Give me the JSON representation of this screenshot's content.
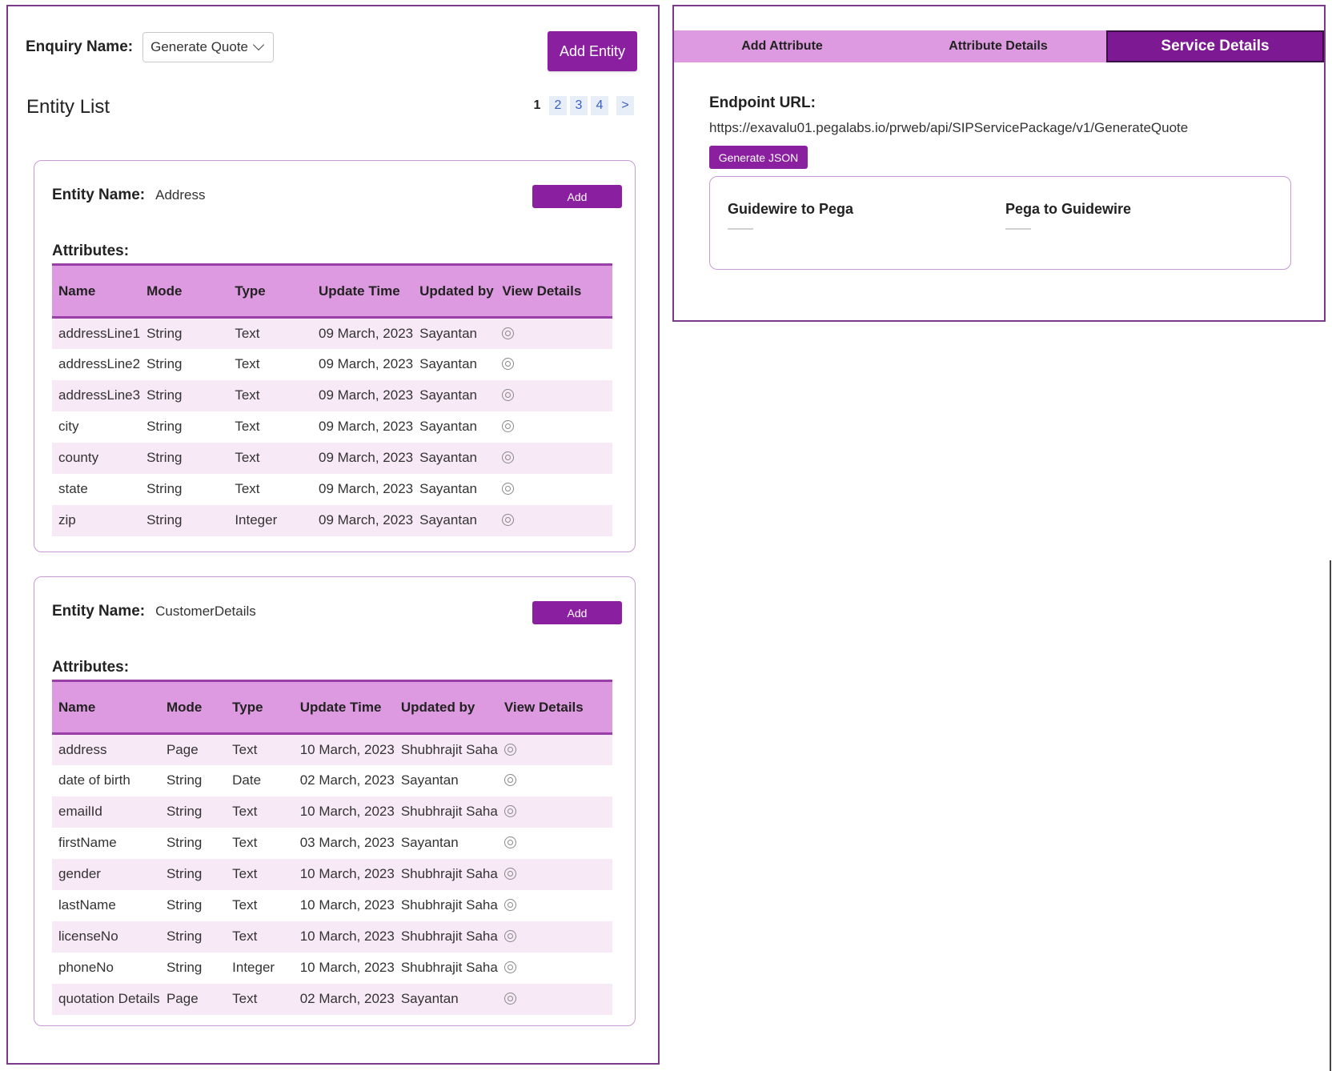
{
  "enquiry": {
    "label": "Enquiry Name:",
    "selected": "Generate Quote"
  },
  "add_entity_label": "Add Entity",
  "entity_list_title": "Entity List",
  "pagination": {
    "current": "1",
    "pages": [
      "2",
      "3",
      "4"
    ],
    "next": ">"
  },
  "entities": [
    {
      "name_label": "Entity Name:",
      "name": "Address",
      "add_label": "Add",
      "attributes_label": "Attributes:",
      "columns": [
        "Name",
        "Mode",
        "Type",
        "Update Time",
        "Updated by",
        "View Details"
      ],
      "rows": [
        [
          "addressLine1",
          "String",
          "Text",
          "09 March, 2023",
          "Sayantan"
        ],
        [
          "addressLine2",
          "String",
          "Text",
          "09 March, 2023",
          "Sayantan"
        ],
        [
          "addressLine3",
          "String",
          "Text",
          "09 March, 2023",
          "Sayantan"
        ],
        [
          "city",
          "String",
          "Text",
          "09 March, 2023",
          "Sayantan"
        ],
        [
          "county",
          "String",
          "Text",
          "09 March, 2023",
          "Sayantan"
        ],
        [
          "state",
          "String",
          "Text",
          "09 March, 2023",
          "Sayantan"
        ],
        [
          "zip",
          "String",
          "Integer",
          "09 March, 2023",
          "Sayantan"
        ]
      ]
    },
    {
      "name_label": "Entity Name:",
      "name": "CustomerDetails",
      "add_label": "Add",
      "attributes_label": "Attributes:",
      "columns": [
        "Name",
        "Mode",
        "Type",
        "Update Time",
        "Updated by",
        "View Details"
      ],
      "rows": [
        [
          "address",
          "Page",
          "Text",
          "10 March, 2023",
          "Shubhrajit Saha"
        ],
        [
          "date of birth",
          "String",
          "Date",
          "02 March, 2023",
          "Sayantan"
        ],
        [
          "emailId",
          "String",
          "Text",
          "10 March, 2023",
          "Shubhrajit Saha"
        ],
        [
          "firstName",
          "String",
          "Text",
          "03 March, 2023",
          "Sayantan"
        ],
        [
          "gender",
          "String",
          "Text",
          "10 March, 2023",
          "Shubhrajit Saha"
        ],
        [
          "lastName",
          "String",
          "Text",
          "10 March, 2023",
          "Shubhrajit Saha"
        ],
        [
          "licenseNo",
          "String",
          "Text",
          "10 March, 2023",
          "Shubhrajit Saha"
        ],
        [
          "phoneNo",
          "String",
          "Integer",
          "10 March, 2023",
          "Shubhrajit Saha"
        ],
        [
          "quotation Details",
          "Page",
          "Text",
          "02 March, 2023",
          "Sayantan"
        ]
      ]
    }
  ],
  "right_panel": {
    "tabs": [
      "Add Attribute",
      "Attribute Details",
      "Service Details"
    ],
    "active_tab": "Service Details",
    "endpoint_label": "Endpoint URL:",
    "endpoint_url": "https://exavalu01.pegalabs.io/prweb/api/SIPServicePackage/v1/GenerateQuote",
    "generate_json_label": "Generate JSON",
    "mapping": {
      "left_title": "Guidewire to Pega",
      "right_title": "Pega to Guidewire"
    }
  },
  "colors": {
    "accent": "#8a1fa0",
    "header_bg": "#de9ae0",
    "row_stripe": "#f8e9f7",
    "panel_border": "#7b3a8c"
  },
  "icons": {
    "view_details": "view-target-icon",
    "dropdown": "chevron-down-icon"
  }
}
